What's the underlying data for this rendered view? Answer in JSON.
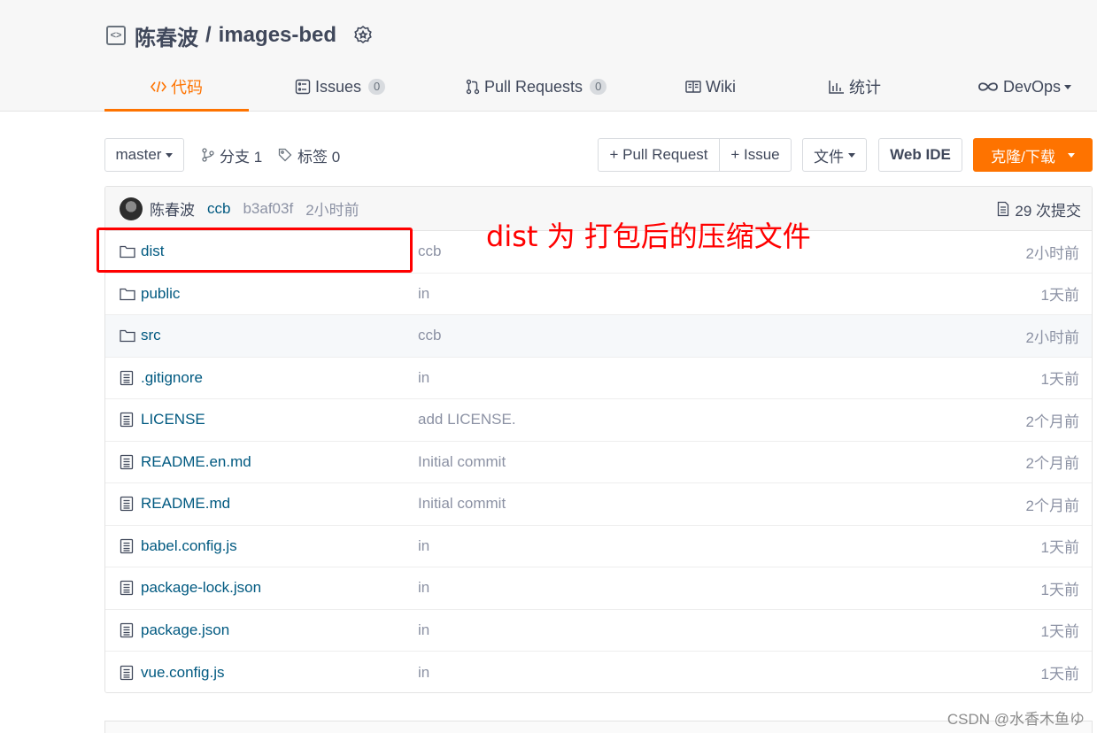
{
  "repo": {
    "owner": "陈春波",
    "separator": "/",
    "name": "images-bed"
  },
  "nav": {
    "tabs": [
      {
        "label": "代码",
        "icon": "code-icon"
      },
      {
        "label": "Issues",
        "count": "0",
        "icon": "issues-icon"
      },
      {
        "label": "Pull Requests",
        "count": "0",
        "icon": "pull-request-icon"
      },
      {
        "label": "Wiki",
        "icon": "wiki-icon"
      },
      {
        "label": "统计",
        "icon": "stats-icon"
      },
      {
        "label": "DevOps",
        "icon": "devops-icon"
      }
    ]
  },
  "toolbar": {
    "branch": "master",
    "branches_label": "分支 1",
    "tags_label": "标签 0",
    "new_pr_label": "+ Pull Request",
    "new_issue_label": "+ Issue",
    "file_label": "文件",
    "web_ide_label": "Web IDE",
    "clone_label": "克隆/下载"
  },
  "commit": {
    "author": "陈春波",
    "message": "ccb",
    "sha": "b3af03f",
    "time": "2小时前",
    "count_label": "29 次提交"
  },
  "files": [
    {
      "name": "dist",
      "type": "folder",
      "message": "ccb",
      "time": "2小时前"
    },
    {
      "name": "public",
      "type": "folder",
      "message": "in",
      "time": "1天前"
    },
    {
      "name": "src",
      "type": "folder",
      "message": "ccb",
      "time": "2小时前"
    },
    {
      "name": ".gitignore",
      "type": "file",
      "message": "in",
      "time": "1天前"
    },
    {
      "name": "LICENSE",
      "type": "file",
      "message": "add LICENSE.",
      "time": "2个月前"
    },
    {
      "name": "README.en.md",
      "type": "file",
      "message": "Initial commit",
      "time": "2个月前"
    },
    {
      "name": "README.md",
      "type": "file",
      "message": "Initial commit",
      "time": "2个月前"
    },
    {
      "name": "babel.config.js",
      "type": "file",
      "message": "in",
      "time": "1天前"
    },
    {
      "name": "package-lock.json",
      "type": "file",
      "message": "in",
      "time": "1天前"
    },
    {
      "name": "package.json",
      "type": "file",
      "message": "in",
      "time": "1天前"
    },
    {
      "name": "vue.config.js",
      "type": "file",
      "message": "in",
      "time": "1天前"
    }
  ],
  "annotation": {
    "text": "dist 为 打包后的压缩文件",
    "color": "#ff0000"
  },
  "watermark": "CSDN @水香木鱼ゆ",
  "colors": {
    "accent": "#fe7300",
    "link": "#005980",
    "muted": "#8c92a4"
  }
}
